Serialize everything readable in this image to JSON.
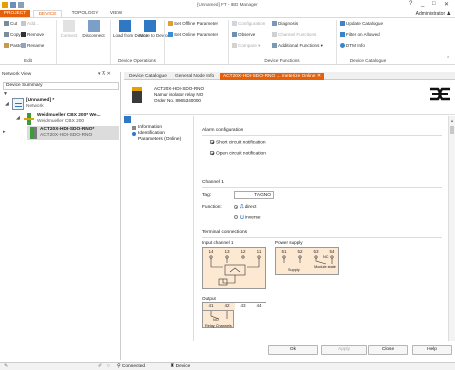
{
  "window": {
    "title": "[Unnamed] FT - IBD Manager",
    "controls": [
      "?",
      "_",
      "□",
      "✕"
    ]
  },
  "ribbon_tabs": [
    {
      "label": "PROJECT"
    },
    {
      "label": "DEVICE"
    },
    {
      "label": "TOPOLOGY"
    },
    {
      "label": "VIEW"
    }
  ],
  "user": "Administrator",
  "ribbon": {
    "edit": {
      "cut": "Cut",
      "copy": "Copy",
      "paste": "Paste",
      "add": "Add...",
      "remove": "Remove",
      "rename": "Rename",
      "label": "Edit"
    },
    "connect": "Connect",
    "disconnect": "Disconnect",
    "load_from_device": "Load from Device",
    "store_to_device": "Store to Device",
    "device_operations": "Device Operations",
    "set_offline": "Set Offline Parameter",
    "set_online": "Set Online Parameter",
    "configuration": "Configuration",
    "observe": "Observe",
    "compare": "Compare",
    "diagnosis": "Diagnosis",
    "channel_functions": "Channel Functions",
    "additional_functions": "Additional Functions",
    "device_functions": "Device Functions",
    "update_catalogue": "Update Catalogue",
    "filter_on_allowed": "Filter on Allowed",
    "dtm_info": "DTM Info",
    "device_catalogue": "Device Catalogue"
  },
  "network_view": {
    "title": "Network View",
    "controls": "▾ ⊼ ✕",
    "device_summary": "Device Summary",
    "tree": [
      {
        "title": "[Unnamed] *",
        "subtitle": "Network"
      },
      {
        "title": "Weidmueller CBX 200* We...",
        "subtitle": "Weidmueller CBX 200"
      },
      {
        "title": "ACT20X-HDI-SDO-RNO*",
        "subtitle": "ACT20X-HDI-SDO-RNO"
      }
    ]
  },
  "doc_tabs": [
    {
      "label": "Device Catalogue"
    },
    {
      "label": "General Node Info"
    },
    {
      "label": "ACT20X-HDI-SDO-RNO ... meterize Online  ✕"
    }
  ],
  "device_header": {
    "line1": "ACT20X-HDI-SDO-RNO",
    "line2": "Namur isolator relay NO",
    "line3": "Order No. 8965340000"
  },
  "device_nav": {
    "items": [
      "Information",
      "Identification",
      "Parameters (Online)"
    ]
  },
  "alarm": {
    "heading": "Alarm configuration",
    "short_circuit": "Short circuit notification",
    "open_circuit": "Open circuit notification"
  },
  "channel": {
    "heading": "Channel 1",
    "tag_label": "Tag:",
    "tag_value": "TAGNO",
    "function_label": "Function:",
    "direct": "direct",
    "inverse": "inverse"
  },
  "terminals": {
    "heading": "Terminal connections",
    "input_label": "Input channel 1",
    "power_label": "Power supply",
    "input_terms": [
      "14",
      "13",
      "12",
      "11"
    ],
    "power_terms": [
      "51",
      "52",
      "53",
      "54"
    ],
    "supply": "Supply",
    "module_state": "Module state",
    "nc": "NC",
    "output_label": "Output",
    "output_terms": [
      "41",
      "42",
      "43",
      "44"
    ],
    "no": "NO",
    "relay_channels": "Relay Channels"
  },
  "buttons": {
    "ok": "Ok",
    "apply": "Apply",
    "close": "Close",
    "help": "Help"
  },
  "status": {
    "connection": "Connected",
    "device": "Device"
  },
  "colors": {
    "accent": "#e4600a",
    "brand_yellow": "#f5b400",
    "device_green": "#3f9a3f"
  }
}
